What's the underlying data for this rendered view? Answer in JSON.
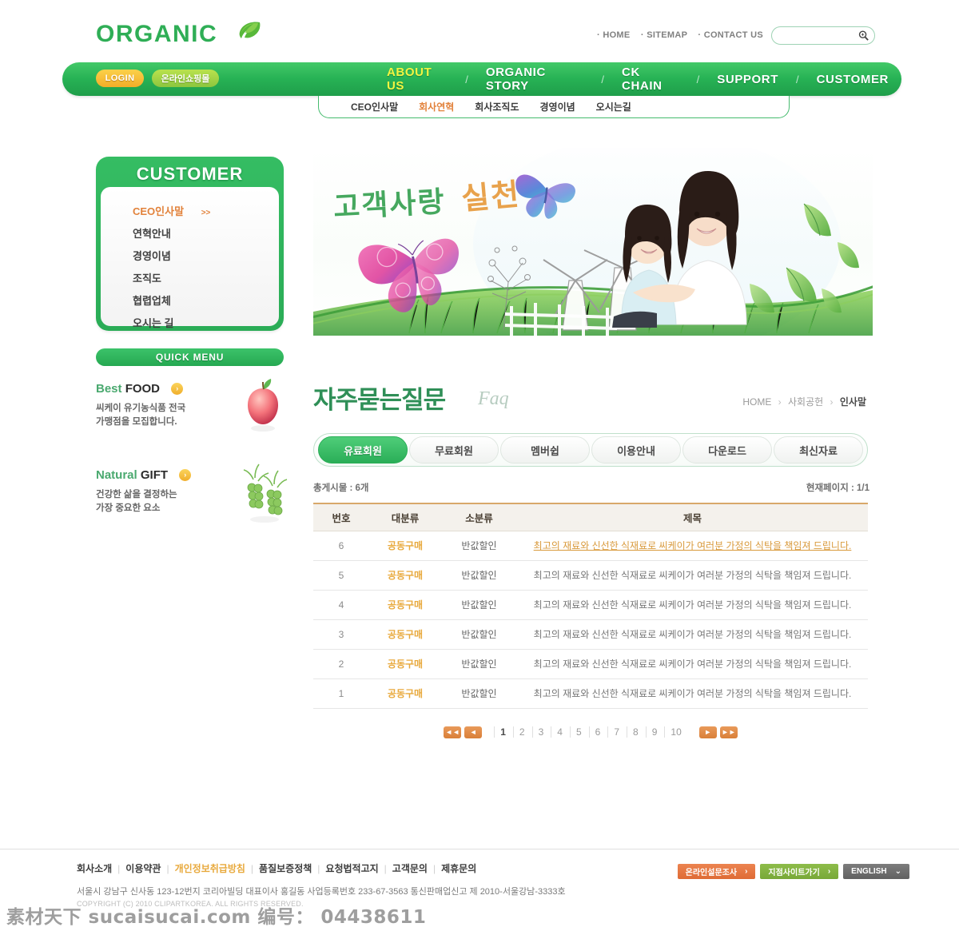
{
  "header": {
    "logo_text": "ORGANIC",
    "logo_icon": "leaf-icon",
    "top_links": [
      "· HOME",
      "· SITEMAP",
      "· CONTACT US"
    ],
    "search": {
      "value": "",
      "placeholder": "",
      "icon": "search-icon"
    }
  },
  "nav": {
    "login_label": "LOGIN",
    "shop_label": "온라인쇼핑몰",
    "separator": "/",
    "items": [
      {
        "label": "ABOUT US",
        "active": true
      },
      {
        "label": "ORGANIC STORY",
        "active": false
      },
      {
        "label": "CK CHAIN",
        "active": false
      },
      {
        "label": "SUPPORT",
        "active": false
      },
      {
        "label": "CUSTOMER",
        "active": false
      }
    ]
  },
  "subnav": {
    "items": [
      {
        "label": "CEO인사말",
        "active": false
      },
      {
        "label": "회사연혁",
        "active": true
      },
      {
        "label": "회사조직도",
        "active": false
      },
      {
        "label": "경영이념",
        "active": false
      },
      {
        "label": "오시는길",
        "active": false
      }
    ]
  },
  "sidebar": {
    "customer": {
      "title": "CUSTOMER",
      "items": [
        {
          "label": "CEO인사말",
          "active": true,
          "arrow": ">>"
        },
        {
          "label": "연혁안내",
          "active": false
        },
        {
          "label": "경영이념",
          "active": false
        },
        {
          "label": "조직도",
          "active": false
        },
        {
          "label": "협렵업체",
          "active": false
        },
        {
          "label": "오시는 길",
          "active": false
        }
      ]
    },
    "quick_menu": {
      "title": "QUICK MENU",
      "items": [
        {
          "title_light": "Best ",
          "title_bold": "FOOD",
          "arrow": "›",
          "desc_line1": "씨케이 유기농식품 전국",
          "desc_line2": "가맹점을 모집합니다.",
          "image": "apple-icon"
        },
        {
          "title_light": "Natural ",
          "title_bold": "GIFT",
          "arrow": "›",
          "desc_line1": "건강한 삶을 결정하는",
          "desc_line2": "가장 중요한 요소",
          "image": "sprout-icon"
        }
      ]
    }
  },
  "hero": {
    "title_green": "고객사랑",
    "title_orange": "실천",
    "decorations": [
      "butterfly-pink-icon",
      "butterfly-blue-icon",
      "windmill-icon",
      "grass-icon",
      "leaves-icon",
      "mother-child-photo"
    ]
  },
  "main": {
    "page_title": "자주묻는질문",
    "page_title_en": "Faq",
    "breadcrumb": {
      "items": [
        "HOME",
        "사회공헌",
        "인사말"
      ],
      "separator": "›"
    },
    "tabs": [
      {
        "label": "유료회원",
        "active": true
      },
      {
        "label": "무료회원",
        "active": false
      },
      {
        "label": "멤버쉽",
        "active": false
      },
      {
        "label": "이용안내",
        "active": false
      },
      {
        "label": "다운로드",
        "active": false
      },
      {
        "label": "최신자료",
        "active": false
      }
    ],
    "total_label": "총게시물 : 6개",
    "page_label": "현재페이지 : 1/1",
    "table": {
      "columns": [
        "번호",
        "대분류",
        "소분류",
        "제목"
      ],
      "rows": [
        {
          "no": "6",
          "cat": "공동구매",
          "sub": "반값할인",
          "title": "최고의 재료와 신선한 식재료로 씨케이가 여러분 가정의 식탁을 책임져 드립니다.",
          "highlight": true
        },
        {
          "no": "5",
          "cat": "공동구매",
          "sub": "반값할인",
          "title": "최고의 재료와 신선한 식재료로 씨케이가 여러분 가정의 식탁을 책임져 드립니다.",
          "highlight": false
        },
        {
          "no": "4",
          "cat": "공동구매",
          "sub": "반값할인",
          "title": "최고의 재료와 신선한 식재료로 씨케이가 여러분 가정의 식탁을 책임져 드립니다.",
          "highlight": false
        },
        {
          "no": "3",
          "cat": "공동구매",
          "sub": "반값할인",
          "title": "최고의 재료와 신선한 식재료로 씨케이가 여러분 가정의 식탁을 책임져 드립니다.",
          "highlight": false
        },
        {
          "no": "2",
          "cat": "공동구매",
          "sub": "반값할인",
          "title": "최고의 재료와 신선한 식재료로 씨케이가 여러분 가정의 식탁을 책임져 드립니다.",
          "highlight": false
        },
        {
          "no": "1",
          "cat": "공동구매",
          "sub": "반값할인",
          "title": "최고의 재료와 신선한 식재료로 씨케이가 여러분 가정의 식탁을 책임져 드립니다.",
          "highlight": false
        }
      ]
    },
    "pagination": {
      "first": "◄◄",
      "prev": "◄",
      "pages": [
        "1",
        "2",
        "3",
        "4",
        "5",
        "6",
        "7",
        "8",
        "9",
        "10"
      ],
      "current": "1",
      "next": "►",
      "last": "►►"
    }
  },
  "footer": {
    "links": [
      {
        "label": "회사소개",
        "highlight": false
      },
      {
        "label": "이용약관",
        "highlight": false
      },
      {
        "label": "개인정보취급방침",
        "highlight": true
      },
      {
        "label": "품질보증정책",
        "highlight": false
      },
      {
        "label": "요청법적고지",
        "highlight": false
      },
      {
        "label": "고객문의",
        "highlight": false
      },
      {
        "label": "제휴문의",
        "highlight": false
      }
    ],
    "divider": "|",
    "address": "서울시 강남구 신사동 123-12번지 코리아빌딩  대표이사 홍길동 사업등록번호 233-67-3563 통신판매업신고 제 2010-서울강남-3333호",
    "copyright": "COPYRIGHT (C) 2010 CLIPARTKOREA. ALL RIGHTS RESERVED.",
    "buttons": [
      {
        "label": "온라인설문조사",
        "arrow": "›",
        "style": "orange"
      },
      {
        "label": "지점사이트가기",
        "arrow": "›",
        "style": "green"
      },
      {
        "label": "ENGLISH",
        "arrow": "⌄",
        "style": "grey"
      }
    ]
  },
  "watermark": {
    "text": "素材天下 sucaisucai.com  编号： 04438611"
  }
}
